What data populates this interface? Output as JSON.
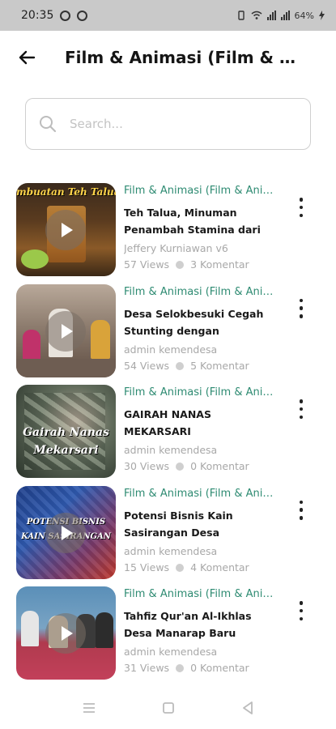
{
  "status": {
    "time": "20:35",
    "battery": "64%"
  },
  "header": {
    "title": "Film & Animasi (Film & Animasi (Film & Animasi)"
  },
  "search": {
    "placeholder": "Search..."
  },
  "videos": [
    {
      "category": "Film & Animasi (Film & Animasi)",
      "title": "Teh Talua, Minuman Penambah Stamina dari Sumatra Barat",
      "author": "Jeffery Kurniawan v6",
      "views": "57 Views",
      "comments": "3 Komentar",
      "thumb_caption": "mbuatan Teh Talua"
    },
    {
      "category": "Film & Animasi (Film & Animasi)",
      "title": "Desa Selokbesuki Cegah Stunting dengan Posyandu",
      "author": "admin kemendesa",
      "views": "54 Views",
      "comments": "5 Komentar",
      "thumb_caption": ""
    },
    {
      "category": "Film & Animasi (Film & Animasi)",
      "title": "GAIRAH NANAS MEKARSARI",
      "author": "admin kemendesa",
      "views": "30 Views",
      "comments": "0 Komentar",
      "thumb_caption": "Gairah Nanas Mekarsari"
    },
    {
      "category": "Film & Animasi (Film & Animasi)",
      "title": "Potensi Bisnis Kain Sasirangan Desa Pematang",
      "author": "admin kemendesa",
      "views": "15 Views",
      "comments": "4 Komentar",
      "thumb_caption": "POTENSI BISNIS KAIN SASIRANGAN"
    },
    {
      "category": "Film & Animasi (Film & Animasi)",
      "title": "Tahfiz Qur'an Al-Ikhlas Desa Manarap Baru Kalimantan",
      "author": "admin kemendesa",
      "views": "31 Views",
      "comments": "0 Komentar",
      "thumb_caption": ""
    }
  ],
  "icons": {
    "back": "arrow-left-icon",
    "search": "search-icon",
    "more": "more-vertical-icon",
    "play": "play-icon"
  },
  "colors": {
    "category": "#2e8b72",
    "meta": "#a8a8a8",
    "status_bar": "#c9c9c9"
  }
}
